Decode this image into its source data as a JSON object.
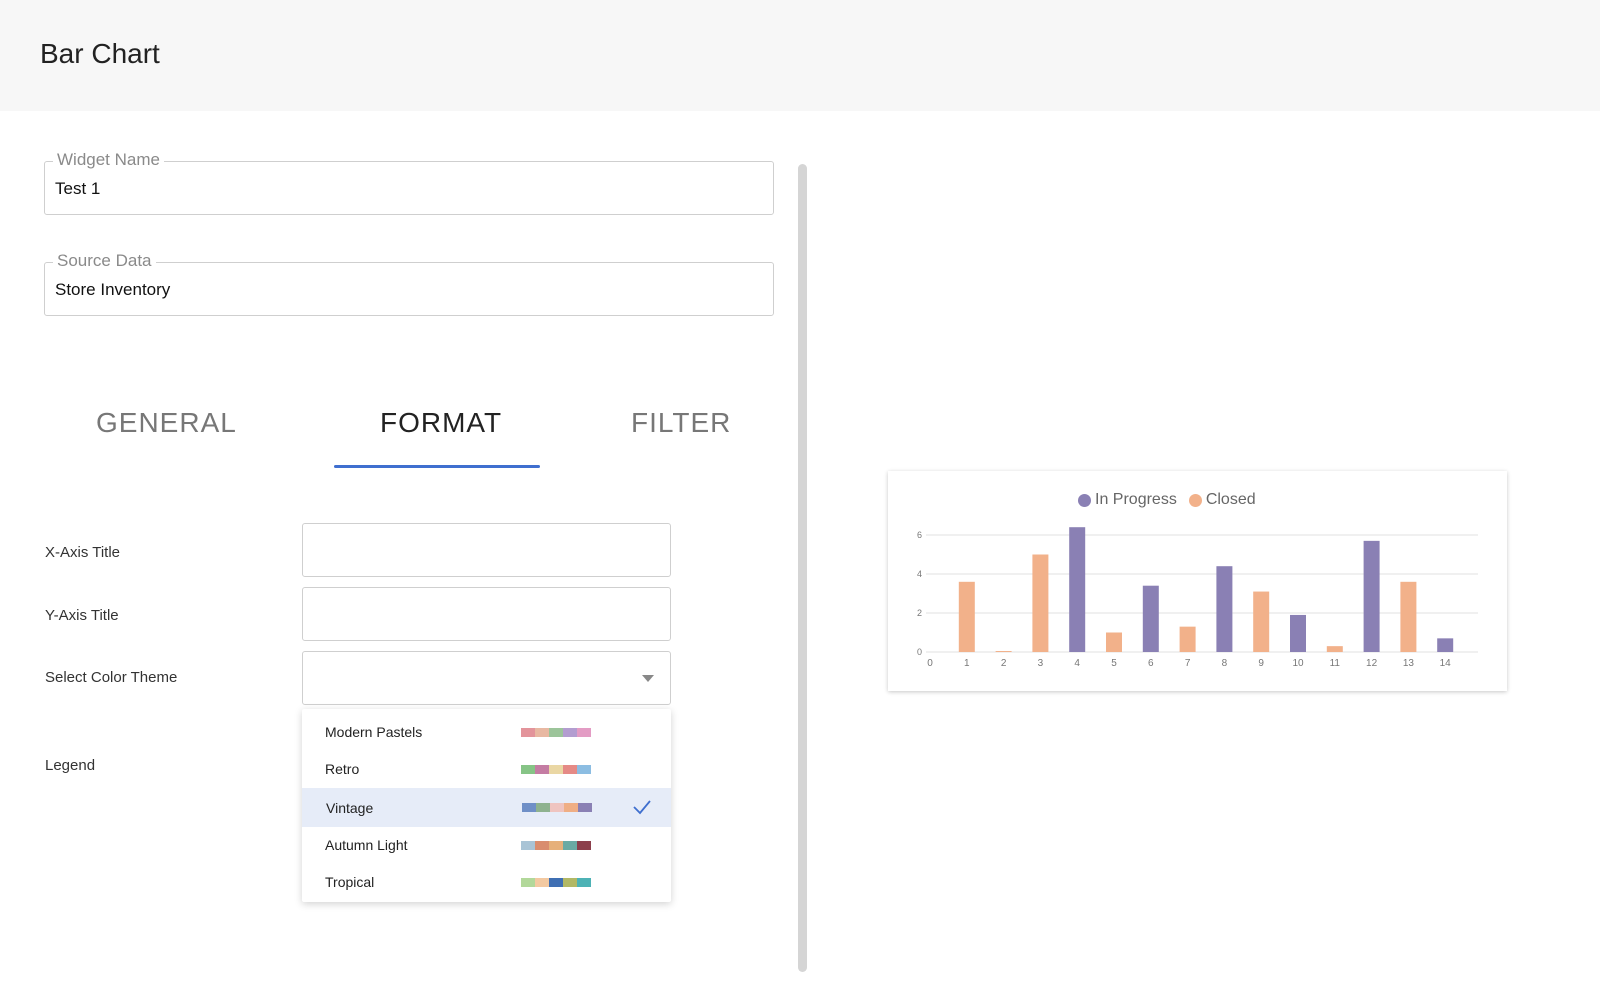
{
  "header": {
    "title": "Bar Chart"
  },
  "form": {
    "widget_name": {
      "label": "Widget Name",
      "value": "Test 1"
    },
    "source_data": {
      "label": "Source Data",
      "value": "Store Inventory"
    }
  },
  "tabs": [
    {
      "label": "GENERAL",
      "active": false
    },
    {
      "label": "FORMAT",
      "active": true
    },
    {
      "label": "FILTER",
      "active": false
    }
  ],
  "format": {
    "xaxis_title_label": "X-Axis Title",
    "xaxis_title_value": "",
    "yaxis_title_label": "Y-Axis Title",
    "yaxis_title_value": "",
    "color_theme_label": "Select Color Theme",
    "color_theme_value": "",
    "legend_label": "Legend"
  },
  "color_themes": [
    {
      "name": "Modern Pastels",
      "selected": false,
      "colors": [
        "#e3949b",
        "#e8b8a2",
        "#9cc49a",
        "#b39dd0",
        "#e39cc4"
      ]
    },
    {
      "name": "Retro",
      "selected": false,
      "colors": [
        "#86c486",
        "#c47ca3",
        "#ead7a4",
        "#e58a86",
        "#8cbde2"
      ]
    },
    {
      "name": "Vintage",
      "selected": true,
      "colors": [
        "#6f8fc7",
        "#8eb28f",
        "#efc4c0",
        "#efae85",
        "#8a80b4"
      ]
    },
    {
      "name": "Autumn Light",
      "selected": false,
      "colors": [
        "#a9c4d6",
        "#d98d6e",
        "#e6b07a",
        "#6aaaa3",
        "#8c3f4b"
      ]
    },
    {
      "name": "Tropical",
      "selected": false,
      "colors": [
        "#b2d89a",
        "#f3c9a1",
        "#3f6fb3",
        "#b2b865",
        "#4db2b5"
      ]
    }
  ],
  "chart_data": {
    "type": "bar",
    "categories": [
      "0",
      "1",
      "2",
      "3",
      "4",
      "5",
      "6",
      "7",
      "8",
      "9",
      "10",
      "11",
      "12",
      "13",
      "14"
    ],
    "series": [
      {
        "name": "In Progress",
        "color": "#8a80b4",
        "values": [
          0,
          0,
          0,
          0,
          6.4,
          0,
          3.4,
          0,
          4.4,
          0,
          1.9,
          0,
          5.7,
          0,
          0.7
        ]
      },
      {
        "name": "Closed",
        "color": "#f2b18a",
        "values": [
          0,
          3.6,
          0.05,
          5.0,
          0,
          1.0,
          0,
          1.3,
          0,
          3.1,
          0,
          0.3,
          0,
          3.6,
          0
        ]
      }
    ],
    "ylim": [
      0,
      6
    ],
    "yticks": [
      "0",
      "2",
      "4",
      "6"
    ],
    "legend": "top-center",
    "grid": true
  }
}
